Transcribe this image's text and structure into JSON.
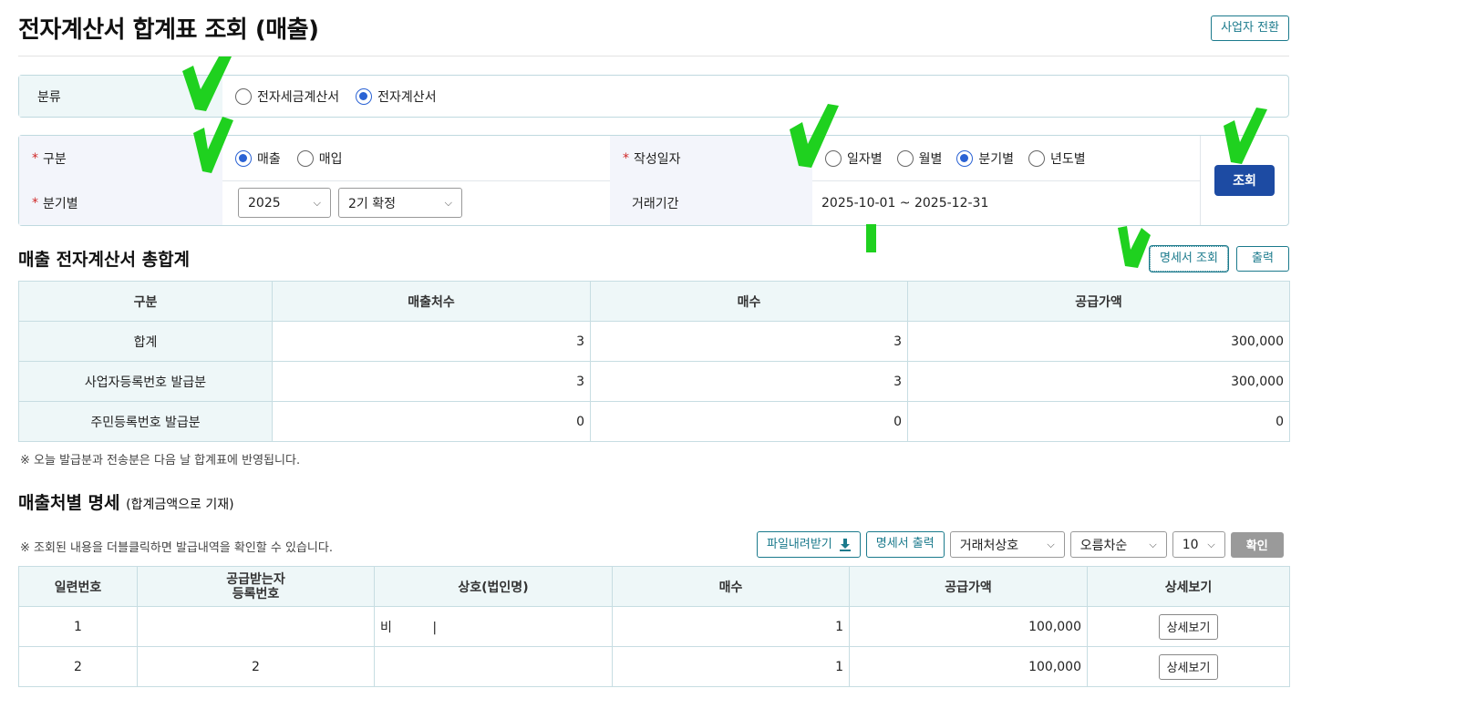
{
  "page_title": "전자계산서 합계표 조회 (매출)",
  "switch_business_label": "사업자 전환",
  "category": {
    "label": "분류",
    "options": [
      "전자세금계산서",
      "전자계산서"
    ],
    "selected": "전자계산서"
  },
  "search": {
    "type_label": "구분",
    "type_options": [
      "매출",
      "매입"
    ],
    "type_selected": "매출",
    "date_label": "작성일자",
    "date_options": [
      "일자별",
      "월별",
      "분기별",
      "년도별"
    ],
    "date_selected": "분기별",
    "quarter_label": "분기별",
    "year_value": "2025",
    "period_value": "2기 확정",
    "range_label": "거래기간",
    "range_value": "2025-10-01 ~ 2025-12-31",
    "search_button": "조회"
  },
  "summary": {
    "title": "매출 전자계산서 총합계",
    "statement_button": "명세서 조회",
    "print_button": "출력",
    "headers": [
      "구분",
      "매출처수",
      "매수",
      "공급가액"
    ],
    "rows": [
      [
        "합계",
        "3",
        "3",
        "300,000"
      ],
      [
        "사업자등록번호 발급분",
        "3",
        "3",
        "300,000"
      ],
      [
        "주민등록번호 발급분",
        "0",
        "0",
        "0"
      ]
    ],
    "note": "※ 오늘 발급분과 전송분은 다음 날 합계표에 반영됩니다."
  },
  "detail": {
    "title": "매출처별 명세",
    "subtitle": "(합계금액으로 기재)",
    "note": "※ 조회된 내용을 더블클릭하면 발급내역을 확인할 수 있습니다.",
    "download_button": "파일내려받기",
    "print_statement_button": "명세서 출력",
    "sort_field": "거래처상호",
    "sort_order": "오름차순",
    "page_size": "10",
    "confirm_button": "확인",
    "headers": [
      "일련번호",
      "공급받는자\n등록번호",
      "상호(법인명)",
      "매수",
      "공급가액",
      "상세보기"
    ],
    "header_reg_line1": "공급받는자",
    "header_reg_line2": "등록번호",
    "rows": [
      {
        "no": "1",
        "reg": "",
        "name": "비          |",
        "count": "1",
        "amount": "100,000",
        "detail": "상세보기"
      },
      {
        "no": "2",
        "reg": "2",
        "name": "",
        "count": "1",
        "amount": "100,000",
        "detail": "상세보기"
      }
    ]
  },
  "colors": {
    "teal": "#1b7a8c",
    "primary": "#1d4ba3",
    "radio": "#2a62d4",
    "check": "#1fd11f"
  }
}
